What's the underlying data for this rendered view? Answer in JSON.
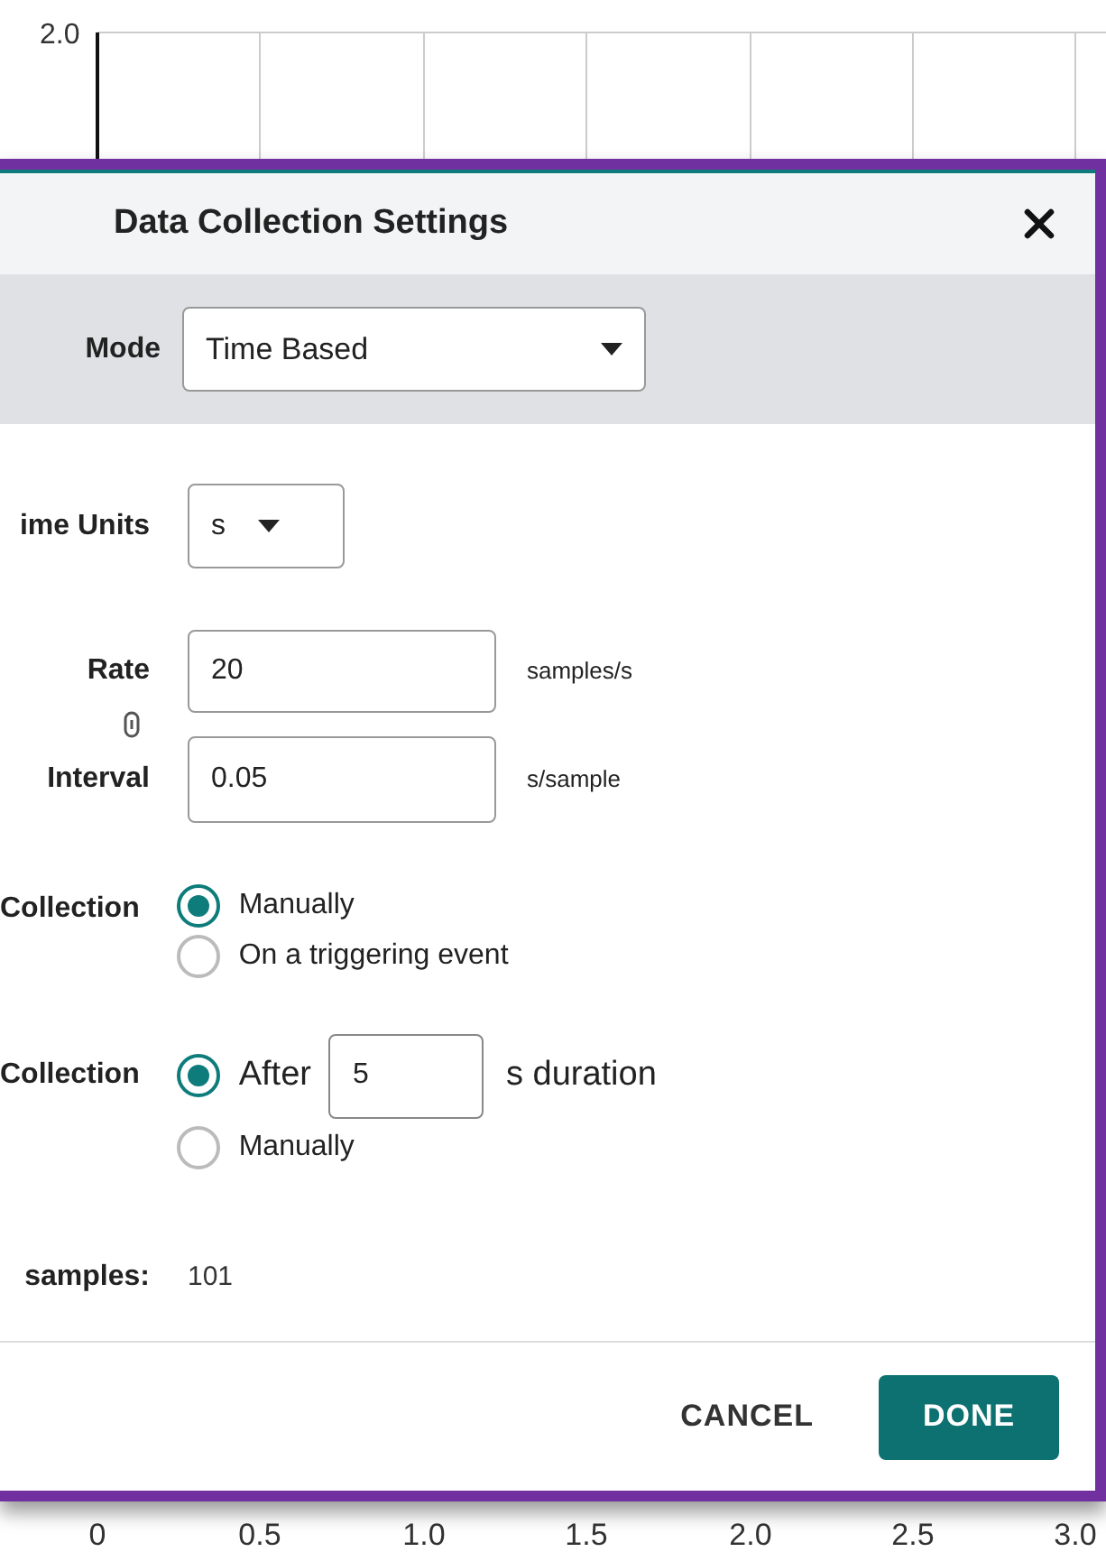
{
  "chart": {
    "y_tick": "2.0",
    "x_ticks": [
      "0",
      "0.5",
      "1.0",
      "1.5",
      "2.0",
      "2.5",
      "3.0"
    ]
  },
  "dialog": {
    "title": "Data Collection Settings",
    "mode": {
      "label": "Mode",
      "value": "Time Based"
    },
    "time_units": {
      "label": "ime Units",
      "value": "s"
    },
    "rate": {
      "label": "Rate",
      "value": "20",
      "unit": "samples/s"
    },
    "interval": {
      "label": "Interval",
      "value": "0.05",
      "unit": "s/sample"
    },
    "start_collection": {
      "label": "Collection",
      "options": [
        {
          "kind": "plain",
          "label": "Manually",
          "selected": true
        },
        {
          "kind": "plain",
          "label": "On a triggering event",
          "selected": false
        }
      ]
    },
    "stop_collection": {
      "label": "Collection",
      "options": [
        {
          "kind": "duration",
          "label": "After",
          "value": "5",
          "unit": "s duration",
          "selected": true
        },
        {
          "kind": "plain",
          "label": "Manually",
          "selected": false
        }
      ]
    },
    "samples": {
      "label": "samples:",
      "value": "101"
    },
    "buttons": [
      {
        "kind": "text",
        "label": "CANCEL"
      },
      {
        "kind": "primary",
        "label": "DONE"
      }
    ]
  }
}
